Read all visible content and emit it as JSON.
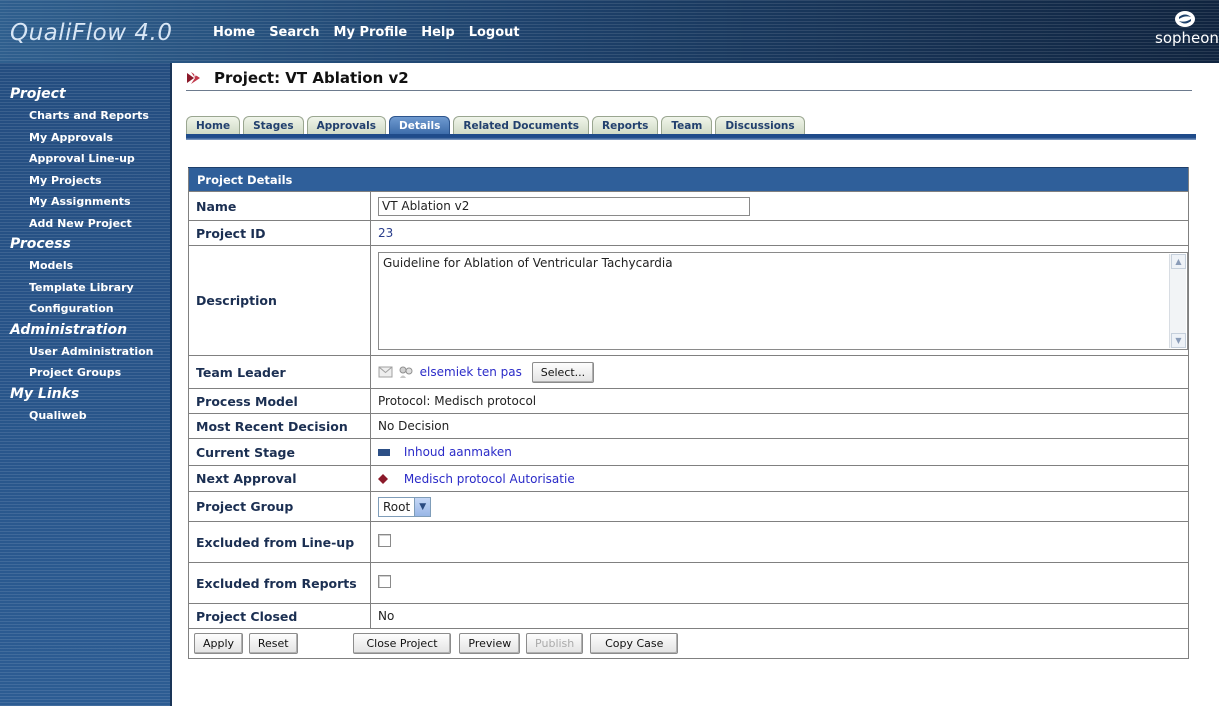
{
  "app": {
    "title": "QualiFlow 4.0",
    "brand": "sopheon",
    "top_nav": [
      "Home",
      "Search",
      "My Profile",
      "Help",
      "Logout"
    ]
  },
  "sidebar": {
    "sections": [
      {
        "heading": "Project",
        "items": [
          "Charts and Reports",
          "My Approvals",
          "Approval Line-up",
          "My Projects",
          "My Assignments",
          "Add New Project"
        ]
      },
      {
        "heading": "Process",
        "items": [
          "Models",
          "Template Library",
          "Configuration"
        ]
      },
      {
        "heading": "Administration",
        "items": [
          "User Administration",
          "Project Groups"
        ]
      },
      {
        "heading": "My Links",
        "items": [
          "Qualiweb"
        ]
      }
    ]
  },
  "page": {
    "title": "Project: VT Ablation v2",
    "tabs": [
      "Home",
      "Stages",
      "Approvals",
      "Details",
      "Related Documents",
      "Reports",
      "Team",
      "Discussions"
    ],
    "active_tab": "Details"
  },
  "details": {
    "header": "Project Details",
    "name_label": "Name",
    "name_value": "VT Ablation v2",
    "id_label": "Project ID",
    "id_value": "23",
    "description_label": "Description",
    "description_value": "Guideline for Ablation of Ventricular Tachycardia",
    "team_leader_label": "Team Leader",
    "team_leader_value": "elsemiek ten pas",
    "select_button": "Select...",
    "process_model_label": "Process Model",
    "process_model_value": "Protocol: Medisch protocol",
    "decision_label": "Most Recent Decision",
    "decision_value": "No Decision",
    "stage_label": "Current Stage",
    "stage_value": "Inhoud aanmaken",
    "approval_label": "Next Approval",
    "approval_value": "Medisch protocol Autorisatie",
    "group_label": "Project Group",
    "group_value": "Root",
    "excluded_lineup_label": "Excluded from Line-up",
    "excluded_lineup_checked": false,
    "excluded_reports_label": "Excluded from Reports",
    "excluded_reports_checked": false,
    "closed_label": "Project Closed",
    "closed_value": "No"
  },
  "actions": {
    "apply": "Apply",
    "reset": "Reset",
    "close_project": "Close Project",
    "preview": "Preview",
    "publish": "Publish",
    "copy_case": "Copy Case"
  },
  "colors": {
    "header_dark": "#10243f",
    "sidebar": "#2c5c93",
    "table_header": "#2f5f9a",
    "link": "#2b2bc8",
    "approval_marker": "#8b1a2a"
  }
}
